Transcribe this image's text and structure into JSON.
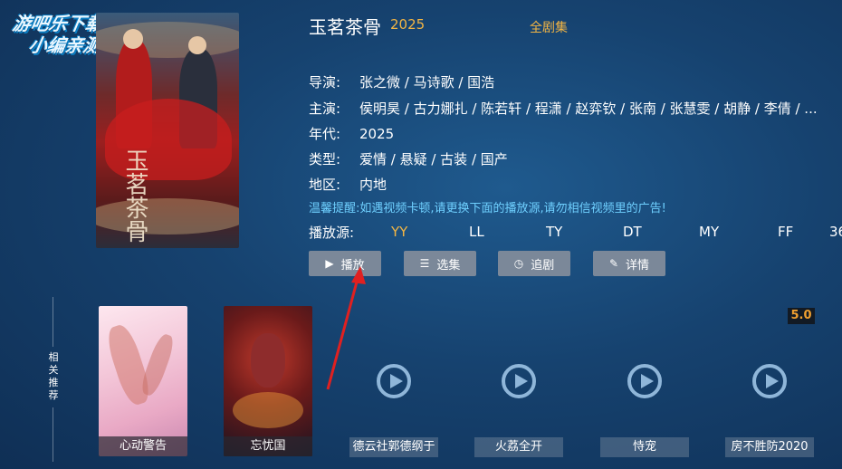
{
  "watermark": {
    "line1": "游吧乐下载",
    "line2": "小编亲测"
  },
  "show": {
    "title": "玉茗茶骨",
    "year": "2025",
    "episodes": "全剧集",
    "poster_text": "玉茗茶骨"
  },
  "info": {
    "director_label": "导演:",
    "director": "张之微 / 马诗歌 / 国浩",
    "cast_label": "主演:",
    "cast": "侯明昊 / 古力娜扎 / 陈若轩 / 程潇 / 赵弈钦 / 张南 / 张慧雯 / 胡静 / 李倩 / ...",
    "year_label": "年代:",
    "year": "2025",
    "genre_label": "类型:",
    "genre": "爱情 / 悬疑 / 古装 / 国产",
    "region_label": "地区:",
    "region": "内地",
    "tip": "温馨提醒:如遇视频卡顿,请更换下面的播放源,请勿相信视频里的广告!"
  },
  "sources": {
    "label": "播放源:",
    "items": [
      "YY",
      "LL",
      "TY",
      "DT",
      "MY",
      "FF",
      "36"
    ],
    "active": "YY"
  },
  "buttons": {
    "play": "播放",
    "select": "选集",
    "follow": "追剧",
    "detail": "详情"
  },
  "related": {
    "label": "相关推荐",
    "rating": "5.0",
    "items": [
      "心动警告",
      "忘忧国",
      "德云社郭德纲于",
      "火荔全开",
      "恃宠",
      "房不胜防2020"
    ]
  },
  "colors": {
    "accent": "#f2b544",
    "tip": "#6fd0ff",
    "button": "#7b8899"
  }
}
